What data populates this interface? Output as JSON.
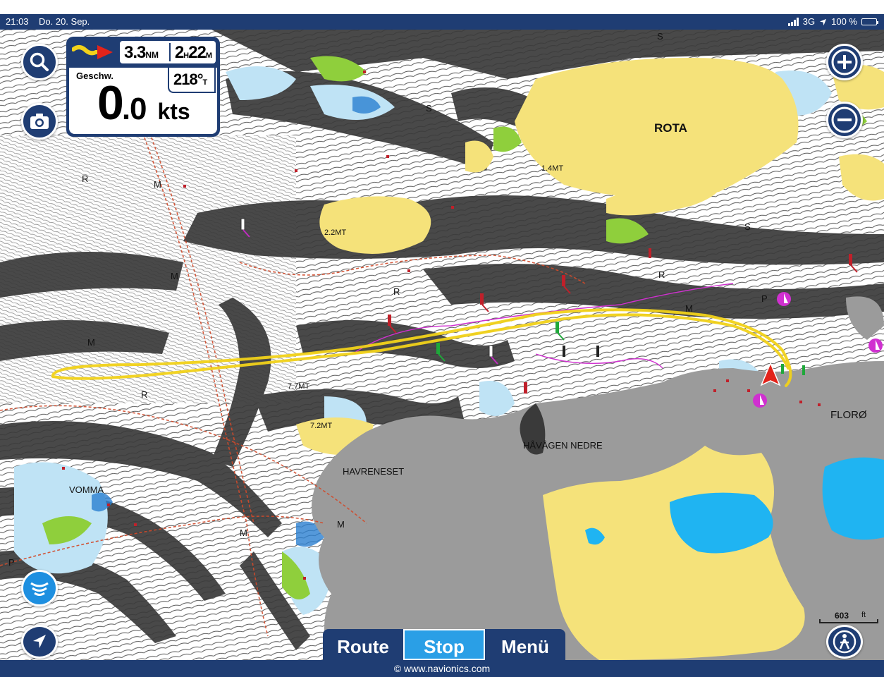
{
  "status_bar": {
    "time": "21:03",
    "date": "Do. 20. Sep.",
    "network": "3G",
    "battery": "100 %"
  },
  "dashboard": {
    "distance_value": "3.3",
    "distance_unit": "NM",
    "time_hours": "2",
    "time_hours_unit": "H",
    "time_minutes": "22",
    "time_minutes_unit": "M",
    "heading_value": "218°",
    "heading_unit": "T",
    "speed_label": "Geschw.",
    "speed_int": "0",
    "speed_dec": ".0",
    "speed_unit": "kts"
  },
  "map_labels": {
    "rota": "ROTA",
    "floro": "FLORØ",
    "havagen": "HÅVÅGEN NEDRE",
    "havreneset": "HAVRENESET",
    "vomma": "VOMMA",
    "depth_1": "1.4MT",
    "depth_2": "2.2MT",
    "depth_3": "7.7MT",
    "depth_4": "7.2MT",
    "m": "M",
    "r": "R",
    "s": "S",
    "p": "P"
  },
  "scale": {
    "value": "603",
    "unit": "ft"
  },
  "tabs": {
    "route": "Route",
    "stop": "Stop",
    "menu": "Menü"
  },
  "footer": "© www.navionics.com",
  "colors": {
    "chrome": "#1f3d73",
    "active_tab": "#2a9fe6",
    "land": "#f5e27a",
    "urban": "#9b9b9b",
    "track": "#f2d21a",
    "shallow": "#bfe3f5"
  },
  "icons": [
    "search-icon",
    "camera-icon",
    "zoom-in-icon",
    "zoom-out-icon",
    "sonar-icon",
    "navigate-icon",
    "person-icon"
  ]
}
